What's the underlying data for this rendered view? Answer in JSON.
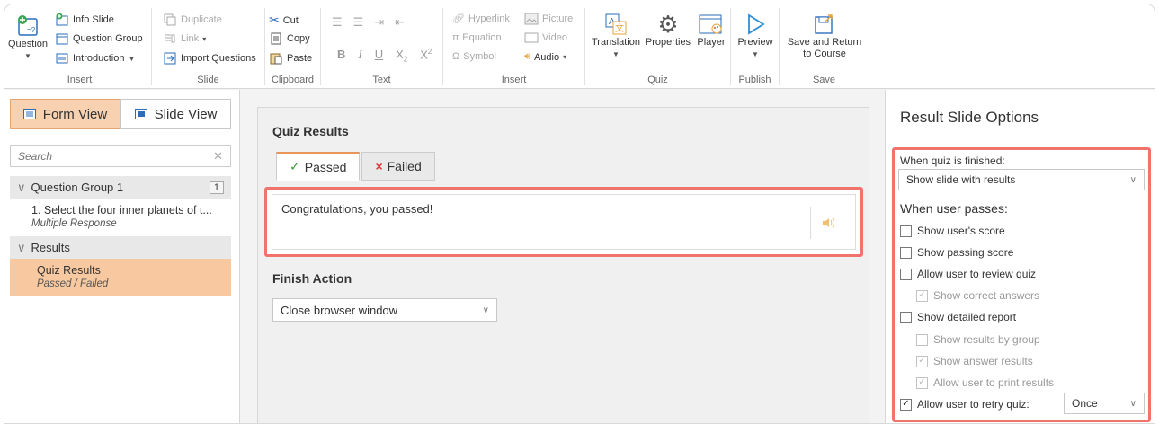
{
  "ribbon": {
    "insert_group": {
      "question": "Question",
      "info_slide": "Info Slide",
      "question_group": "Question Group",
      "introduction": "Introduction",
      "label": "Insert"
    },
    "slide_group": {
      "duplicate": "Duplicate",
      "link": "Link",
      "import_questions": "Import Questions",
      "label": "Slide"
    },
    "clipboard_group": {
      "cut": "Cut",
      "copy": "Copy",
      "paste": "Paste",
      "label": "Clipboard"
    },
    "text_group": {
      "bold": "B",
      "italic": "I",
      "underline": "U",
      "subscript": "X",
      "subscript_suffix": "2",
      "superscript": "X",
      "superscript_suffix": "2",
      "label": "Text"
    },
    "insert2_group": {
      "hyperlink": "Hyperlink",
      "picture": "Picture",
      "equation": "Equation",
      "video": "Video",
      "symbol": "Symbol",
      "audio": "Audio",
      "label": "Insert"
    },
    "quiz_group": {
      "translation": "Translation",
      "properties": "Properties",
      "player": "Player",
      "label": "Quiz"
    },
    "publish_group": {
      "preview": "Preview",
      "label": "Publish"
    },
    "save_group": {
      "save_return": "Save and Return to Course",
      "label": "Save"
    }
  },
  "left": {
    "form_view": "Form View",
    "slide_view": "Slide View",
    "search_placeholder": "Search",
    "tree": {
      "group1": "Question Group 1",
      "group1_count": "1",
      "item1_title": "1. Select the four inner planets of t...",
      "item1_sub": "Multiple Response",
      "results": "Results",
      "quiz_results_title": "Quiz Results",
      "quiz_results_sub": "Passed / Failed"
    }
  },
  "main": {
    "title": "Quiz Results",
    "tabs": {
      "passed": "Passed",
      "failed": "Failed"
    },
    "message": "Congratulations, you passed!",
    "finish_action_title": "Finish Action",
    "finish_action_value": "Close browser window"
  },
  "right": {
    "title": "Result Slide Options",
    "when_finished_label": "When quiz is finished:",
    "when_finished_value": "Show slide with results",
    "when_passes_head": "When user passes:",
    "options": {
      "show_score": "Show user's score",
      "show_passing": "Show passing score",
      "allow_review": "Allow user to review quiz",
      "show_correct": "Show correct answers",
      "show_detailed": "Show detailed report",
      "show_by_group": "Show results by group",
      "show_answer_results": "Show answer results",
      "allow_print": "Allow user to print results",
      "allow_retry": "Allow user to retry quiz:",
      "retry_value": "Once"
    }
  },
  "colors": {
    "accent": "#f0746b",
    "selected_bg": "#f8c9a0",
    "tab_accent": "#e8955a"
  }
}
